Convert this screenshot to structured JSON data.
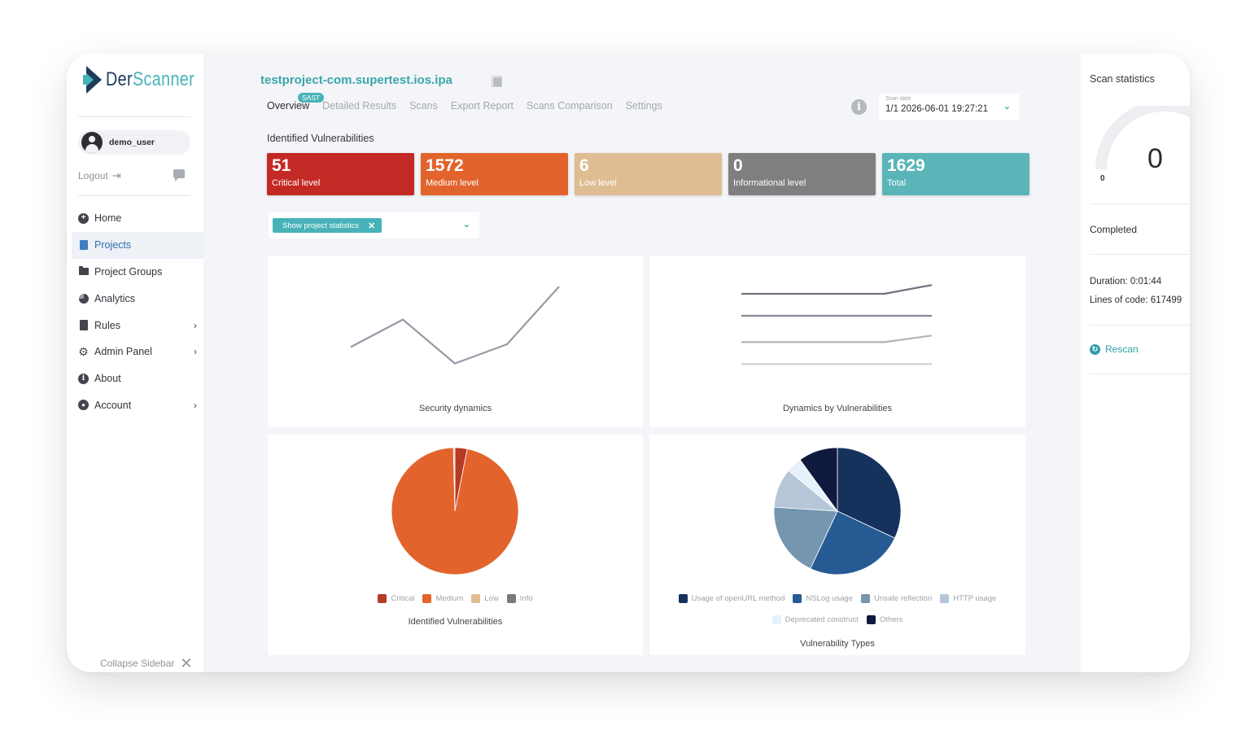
{
  "app": {
    "logo_prefix": "Der",
    "logo_suffix": "Scanner"
  },
  "sidebar": {
    "user": {
      "name": "demo_user"
    },
    "logout_label": "Logout",
    "items": [
      {
        "label": "Home",
        "icon": "plus-circle-icon",
        "active": false,
        "has_submenu": false
      },
      {
        "label": "Projects",
        "icon": "document-icon",
        "active": true,
        "has_submenu": false
      },
      {
        "label": "Project Groups",
        "icon": "folder-icon",
        "active": false,
        "has_submenu": false
      },
      {
        "label": "Analytics",
        "icon": "pie-chart-icon",
        "active": false,
        "has_submenu": false
      },
      {
        "label": "Rules",
        "icon": "clipboard-icon",
        "active": false,
        "has_submenu": true
      },
      {
        "label": "Admin Panel",
        "icon": "gear-icon",
        "active": false,
        "has_submenu": true
      },
      {
        "label": "About",
        "icon": "info-circle-icon",
        "active": false,
        "has_submenu": false
      },
      {
        "label": "Account",
        "icon": "user-circle-icon",
        "active": false,
        "has_submenu": true
      }
    ],
    "collapse_label": "Collapse Sidebar"
  },
  "header": {
    "project_title": "testproject-com.supertest.ios.ipa",
    "tabs": [
      "Overview",
      "Detailed Results",
      "Scans",
      "Export Report",
      "Scans Comparison",
      "Settings"
    ],
    "active_tab": "Overview",
    "badge": "SAST",
    "scan_date": {
      "label": "Scan date",
      "value": "1/1 2026-06-01 19:27:21"
    }
  },
  "vulnerabilities": {
    "title": "Identified Vulnerabilities",
    "cards": [
      {
        "count": "51",
        "label": "Critical level",
        "color": "#c32a25"
      },
      {
        "count": "1572",
        "label": "Medium level",
        "color": "#e2642c"
      },
      {
        "count": "6",
        "label": "Low level",
        "color": "#dfbd93"
      },
      {
        "count": "0",
        "label": "Informational level",
        "color": "#7f7f7f"
      },
      {
        "count": "1629",
        "label": "Total",
        "color": "#5ab5b8"
      }
    ]
  },
  "filter": {
    "tag": "Show project statistics"
  },
  "panels": {
    "security_dynamics": "Security dynamics",
    "dynamics_by_vulnerabilities": "Dynamics by Vulnerabilities",
    "identified_vulnerabilities": "Identified Vulnerabilities",
    "vulnerability_types": "Vulnerability Types"
  },
  "chart_data": [
    {
      "type": "line",
      "title": "Security dynamics",
      "x": [
        1,
        2,
        3,
        4,
        5
      ],
      "series": [
        {
          "values": [
            55,
            65,
            49,
            56,
            77
          ],
          "color": "#9a98a6"
        }
      ],
      "ylim": [
        40,
        80
      ],
      "grid": false
    },
    {
      "type": "line",
      "title": "Dynamics by Vulnerabilities",
      "x": [
        1,
        2,
        3,
        4,
        5
      ],
      "series": [
        {
          "values": [
            100,
            100,
            100,
            100,
            104
          ],
          "color": "#74737f"
        },
        {
          "values": [
            90,
            90,
            90,
            90,
            90
          ],
          "color": "#8a8996"
        },
        {
          "values": [
            78,
            78,
            78,
            78,
            81
          ],
          "color": "#b3b3ba"
        },
        {
          "values": [
            68,
            68,
            68,
            68,
            68
          ],
          "color": "#cfcfd5"
        }
      ],
      "ylim": [
        60,
        110
      ],
      "grid": false
    },
    {
      "type": "pie",
      "title": "Identified Vulnerabilities",
      "categories": [
        "Critical",
        "Medium",
        "Low",
        "Info"
      ],
      "values": [
        51,
        1572,
        6,
        0
      ],
      "colors": [
        "#b73a26",
        "#e2642c",
        "#dfbd93",
        "#7a7a7a"
      ],
      "legend": "bottom"
    },
    {
      "type": "pie",
      "title": "Vulnerability Types",
      "categories": [
        "Usage of openURL method",
        "NSLog usage",
        "Unsafe reflection",
        "HTTP usage",
        "Deprecated construct",
        "Others"
      ],
      "values": [
        32,
        25,
        19,
        10,
        4,
        10
      ],
      "colors": [
        "#15325d",
        "#265a93",
        "#7496af",
        "#b6c6d9",
        "#e7f1fb",
        "#0f1a3e"
      ],
      "legend": "bottom"
    }
  ],
  "scan_statistics": {
    "title": "Scan statistics",
    "progress_value": "0",
    "progress_min": "0",
    "progress_fraction": 0,
    "status": "Completed",
    "duration": "Duration: 0:01:44",
    "lines_of_code": "Lines of code: 617499",
    "rescan_label": "Rescan"
  }
}
